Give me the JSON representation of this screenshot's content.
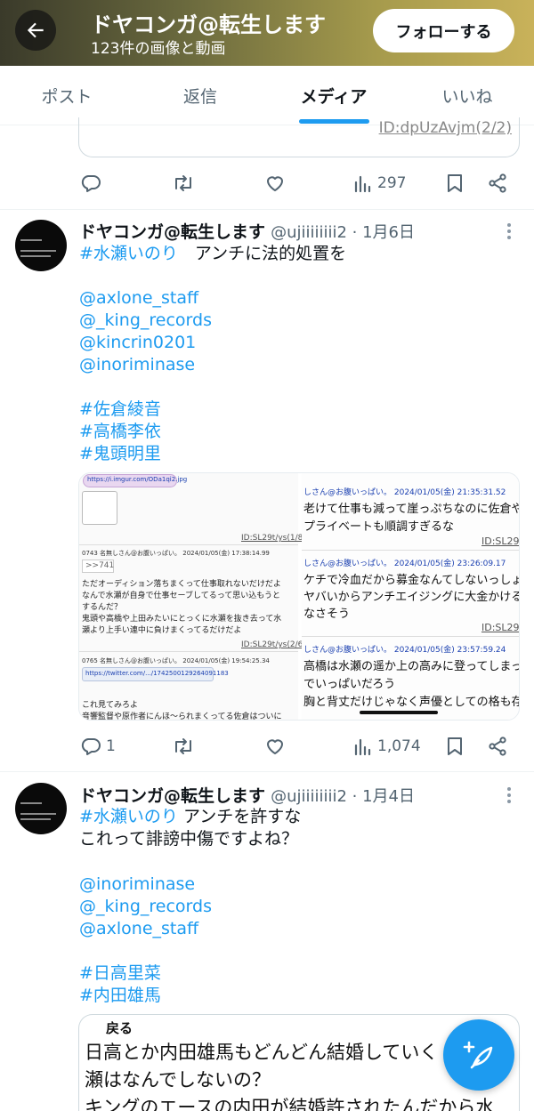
{
  "header": {
    "title": "ドヤコンガ@転生します",
    "subtitle": "123件の画像と動画",
    "follow_label": "フォローする"
  },
  "tabs": [
    {
      "label": "ポスト",
      "active": false
    },
    {
      "label": "返信",
      "active": false
    },
    {
      "label": "メディア",
      "active": true
    },
    {
      "label": "いいね",
      "active": false
    }
  ],
  "prev_post": {
    "card_text": "ID:dpUzAvjm(2/2)",
    "views": "297"
  },
  "posts": [
    {
      "name": "ドヤコンガ@転生します",
      "handle": "@ujiiiiiiii2",
      "date": "1月6日",
      "lines": [
        {
          "tag": "#水瀬いのり",
          "text": "　アンチに法的処置を"
        },
        {
          "text": "@axlone_staff"
        },
        {
          "text": "@_king_records"
        },
        {
          "text": "@kincrin0201"
        },
        {
          "text": "@inoriminase"
        },
        {
          "text": "#佐倉綾音"
        },
        {
          "text": "#高橋李依"
        },
        {
          "text": "#鬼頭明里"
        }
      ],
      "replies": "1",
      "views": "1,074",
      "media": {
        "left": {
          "url1": "https://i.imgur.com/ODa1qi2.jpg",
          "id1": "ID:SL29t/ys(1/8)",
          "meta2": "0743 名無しさん@お腹いっぱい。 2024/01/05(金) 17:38:14.99",
          "quote2": ">>741",
          "body2": [
            "ただオーディション落ちまくって仕事取れないだけだよ",
            "なんで水瀬が自身で仕事セーブしてるって思い込もうと",
            "するんだ？",
            "鬼頭や高橋や上田みたいにとっくに水瀬を抜き去って水",
            "瀬より上手い連中に負けまくってるだけだよ"
          ],
          "id2": "ID:SL29t/ys(2/6)",
          "meta3": "0765 名無しさん@お腹いっぱい。 2024/01/05(金) 19:54:25.34",
          "url3": "https://twitter.com/.../1742500129264091183",
          "body3": [
            "これ見てみろよ",
            "音響監督や原作者にんほ～られまくってる佐倉はついに"
          ]
        },
        "right": {
          "meta1": "しさん@お腹いっぱい。 2024/01/05(金) 21:35:31.52",
          "body1": [
            "老けて仕事も減って崖っぷちなのに佐倉や",
            "プライベートも順調すぎるな"
          ],
          "id1": "ID:SL29",
          "meta2": "しさん@お腹いっぱい。 2024/01/05(金) 23:26:09.17",
          "body2": [
            "ケチで冷血だから募金なんてしないっしょ",
            "ヤバいからアンチエイジングに大金かけるか",
            "なさそう"
          ],
          "id2": "ID:SL29",
          "meta3": "しさん@お腹いっぱい。 2024/01/05(金) 23:57:59.24",
          "body3": [
            "高橋は水瀬の遥か上の高みに登ってしまっ",
            "でいっぱいだろう",
            "胸と背丈だけじゃなく声優としての格も存在"
          ]
        }
      }
    },
    {
      "name": "ドヤコンガ@転生します",
      "handle": "@ujiiiiiiii2",
      "date": "1月4日",
      "lines": [
        {
          "tag": "#水瀬いのり",
          "text": " アンチを許すな"
        },
        {
          "text": "これって誹謗中傷ですよね？"
        },
        {
          "text": "@inoriminase"
        },
        {
          "text": "@_king_records"
        },
        {
          "text": "@axlone_staff"
        },
        {
          "text": "#日高里菜"
        },
        {
          "text": "#内田雄馬"
        }
      ],
      "card": {
        "header": "戻る",
        "lines": [
          "日高とか内田雄馬もどんどん結婚していく",
          "瀬はなんでしないの？",
          "キングのエースの内田が結婚許されたんだから水"
        ]
      }
    }
  ]
}
